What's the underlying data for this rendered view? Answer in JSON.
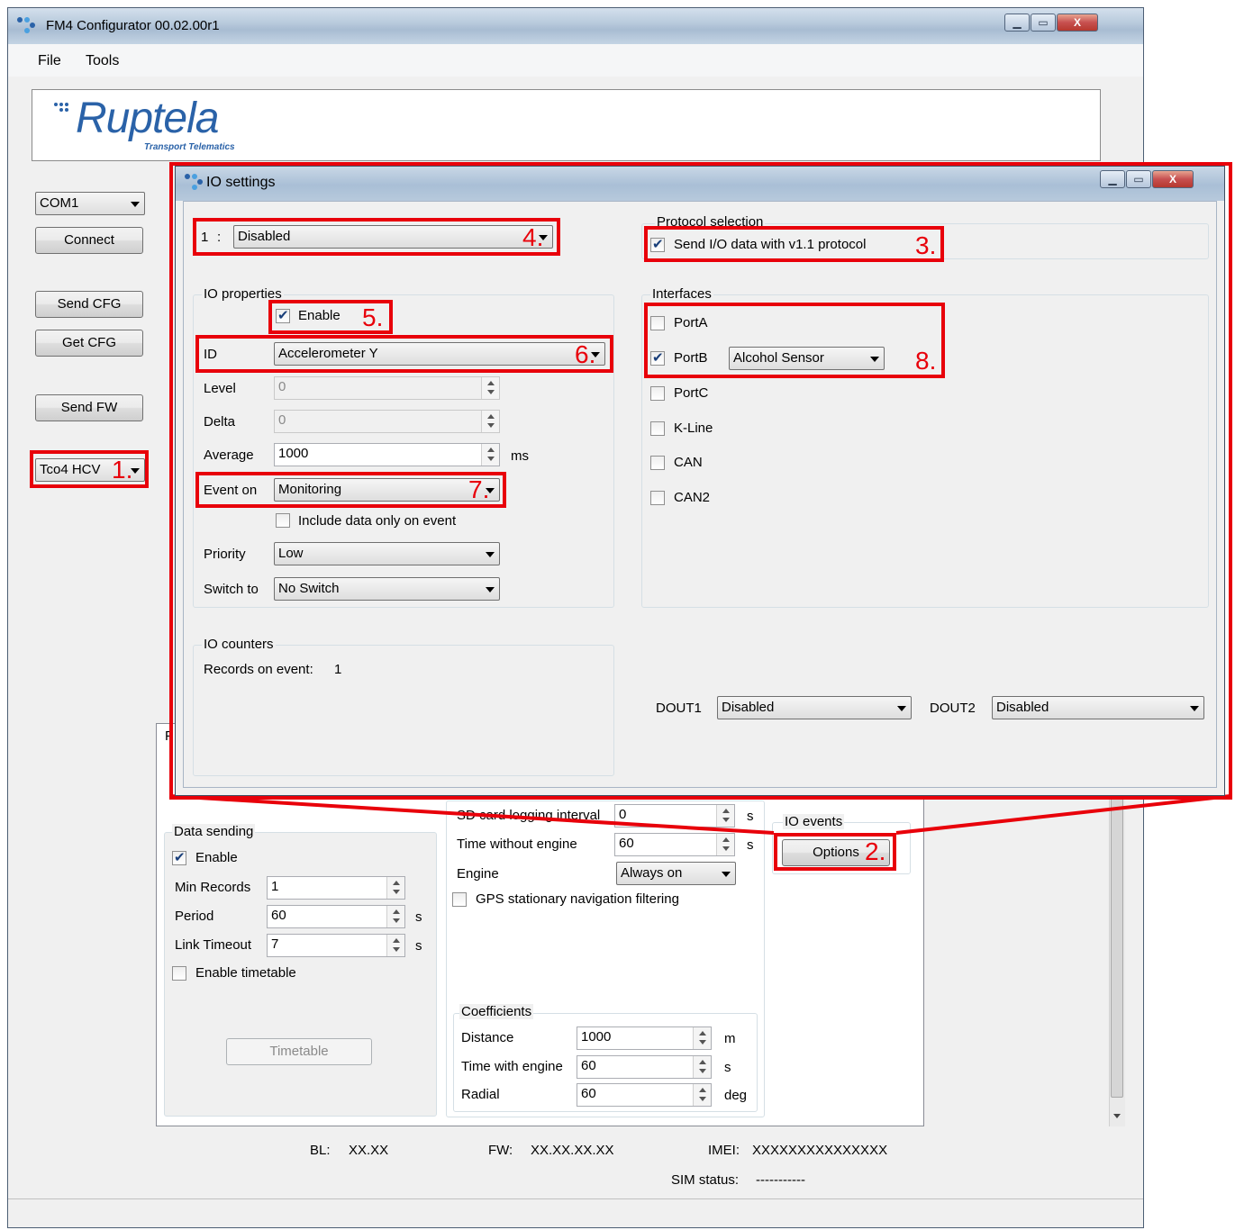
{
  "main_window": {
    "title": "FM4 Configurator 00.02.00r1",
    "menu": [
      "File",
      "Tools"
    ],
    "logo": {
      "word": "Ruptela",
      "sub": "Transport Telematics"
    },
    "port_select": "COM1",
    "buttons": {
      "connect": "Connect",
      "send_cfg": "Send CFG",
      "get_cfg": "Get CFG",
      "send_fw": "Send FW"
    },
    "device_select": "Tco4 HCV",
    "data_sending": {
      "title": "Data sending",
      "enable_label": "Enable",
      "min_records_label": "Min Records",
      "min_records": "1",
      "period_label": "Period",
      "period": "60",
      "period_unit": "s",
      "link_timeout_label": "Link Timeout",
      "link_timeout": "7",
      "link_timeout_unit": "s",
      "timetable_label": "Enable timetable",
      "timetable_button": "Timetable"
    },
    "misc": {
      "sd_card_label": "SD card logging interval",
      "sd_card_value": "0",
      "sd_card_unit": "s",
      "time_without_engine_label": "Time without engine",
      "time_without_engine": "60",
      "time_without_engine_unit": "s",
      "engine_label": "Engine",
      "engine_value": "Always on",
      "gps_filter_label": "GPS stationary navigation filtering"
    },
    "coefficients": {
      "title": "Coefficients",
      "distance_label": "Distance",
      "distance": "1000",
      "distance_unit": "m",
      "time_with_engine_label": "Time with engine",
      "time_with_engine": "60",
      "time_with_engine_unit": "s",
      "radial_label": "Radial",
      "radial": "60",
      "radial_unit": "deg"
    },
    "io_events": {
      "title": "IO events",
      "options_button": "Options"
    },
    "partial_tab_label": "F",
    "status": {
      "bl_label": "BL:",
      "bl": "XX.XX",
      "fw_label": "FW:",
      "fw": "XX.XX.XX.XX",
      "imei_label": "IMEI:",
      "imei": "XXXXXXXXXXXXXXX",
      "sim_label": "SIM status:",
      "sim": "-----------"
    }
  },
  "io_dialog": {
    "title": "IO settings",
    "io_index": "1",
    "io_separator": ":",
    "io_select": "Disabled",
    "protocol": {
      "title": "Protocol selection",
      "send_v11_label": "Send I/O data with v1.1 protocol"
    },
    "io_properties": {
      "title": "IO properties",
      "enable_label": "Enable",
      "id_label": "ID",
      "id_value": "Accelerometer Y",
      "level_label": "Level",
      "level": "0",
      "delta_label": "Delta",
      "delta": "0",
      "average_label": "Average",
      "average": "1000",
      "average_unit": "ms",
      "event_on_label": "Event on",
      "event_on": "Monitoring",
      "include_data_label": "Include data only on event",
      "priority_label": "Priority",
      "priority": "Low",
      "switch_to_label": "Switch to",
      "switch_to": "No Switch"
    },
    "interfaces": {
      "title": "Interfaces",
      "port_a": "PortA",
      "port_b": "PortB",
      "port_b_sensor": "Alcohol Sensor",
      "port_c": "PortC",
      "k_line": "K-Line",
      "can": "CAN",
      "can2": "CAN2"
    },
    "io_counters": {
      "title": "IO counters",
      "records_label": "Records on event:",
      "records": "1"
    },
    "dout1_label": "DOUT1",
    "dout1": "Disabled",
    "dout2_label": "DOUT2",
    "dout2": "Disabled"
  },
  "annotations": [
    "1.",
    "2.",
    "3.",
    "4.",
    "5.",
    "6.",
    "7.",
    "8."
  ],
  "colors": {
    "annotation_red": "#e8000a",
    "logo_blue": "#2a62a8"
  },
  "icons": [
    "app-icon",
    "minimize-icon",
    "maximize-icon",
    "close-icon",
    "dropdown-arrow-icon",
    "spinner-arrows-icon",
    "checkbox-check-icon"
  ]
}
